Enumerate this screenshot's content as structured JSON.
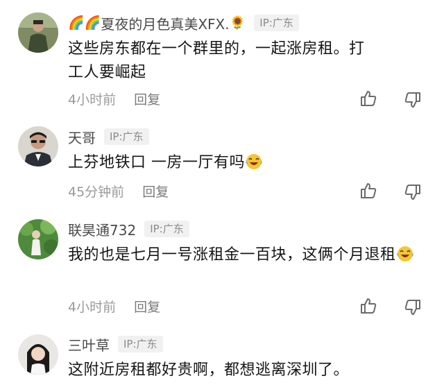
{
  "comments": [
    {
      "prefix_emoji": "🌈🌈",
      "username": "夏夜的月色真美XFX.",
      "suffix_emoji": "🌻",
      "ip": "IP:广东",
      "content": "这些房东都在一个群里的，一起涨房租。打工人要崛起",
      "time": "4小时前",
      "reply": "回复"
    },
    {
      "username": "天哥",
      "ip": "IP:广东",
      "content": "上芬地铁口 一房一厅有吗",
      "time": "45分钟前",
      "reply": "回复"
    },
    {
      "username": "联昊通732",
      "ip": "IP:广东",
      "content": "我的也是七月一号涨租金一百块，这俩个月退租",
      "time": "4小时前",
      "reply": "回复"
    },
    {
      "username": "三叶草",
      "ip": "IP:广东",
      "content": "这附近房租都好贵啊，都想逃离深圳了。"
    }
  ],
  "icons": {
    "inline_emoji": "laughing-crying-icon",
    "like": "thumbs-up-icon",
    "dislike": "thumbs-down-icon"
  },
  "colors": {
    "username": "#4a4a4a",
    "ip_tag_bg": "#f1f1f1",
    "meta": "#9a9a9a"
  }
}
